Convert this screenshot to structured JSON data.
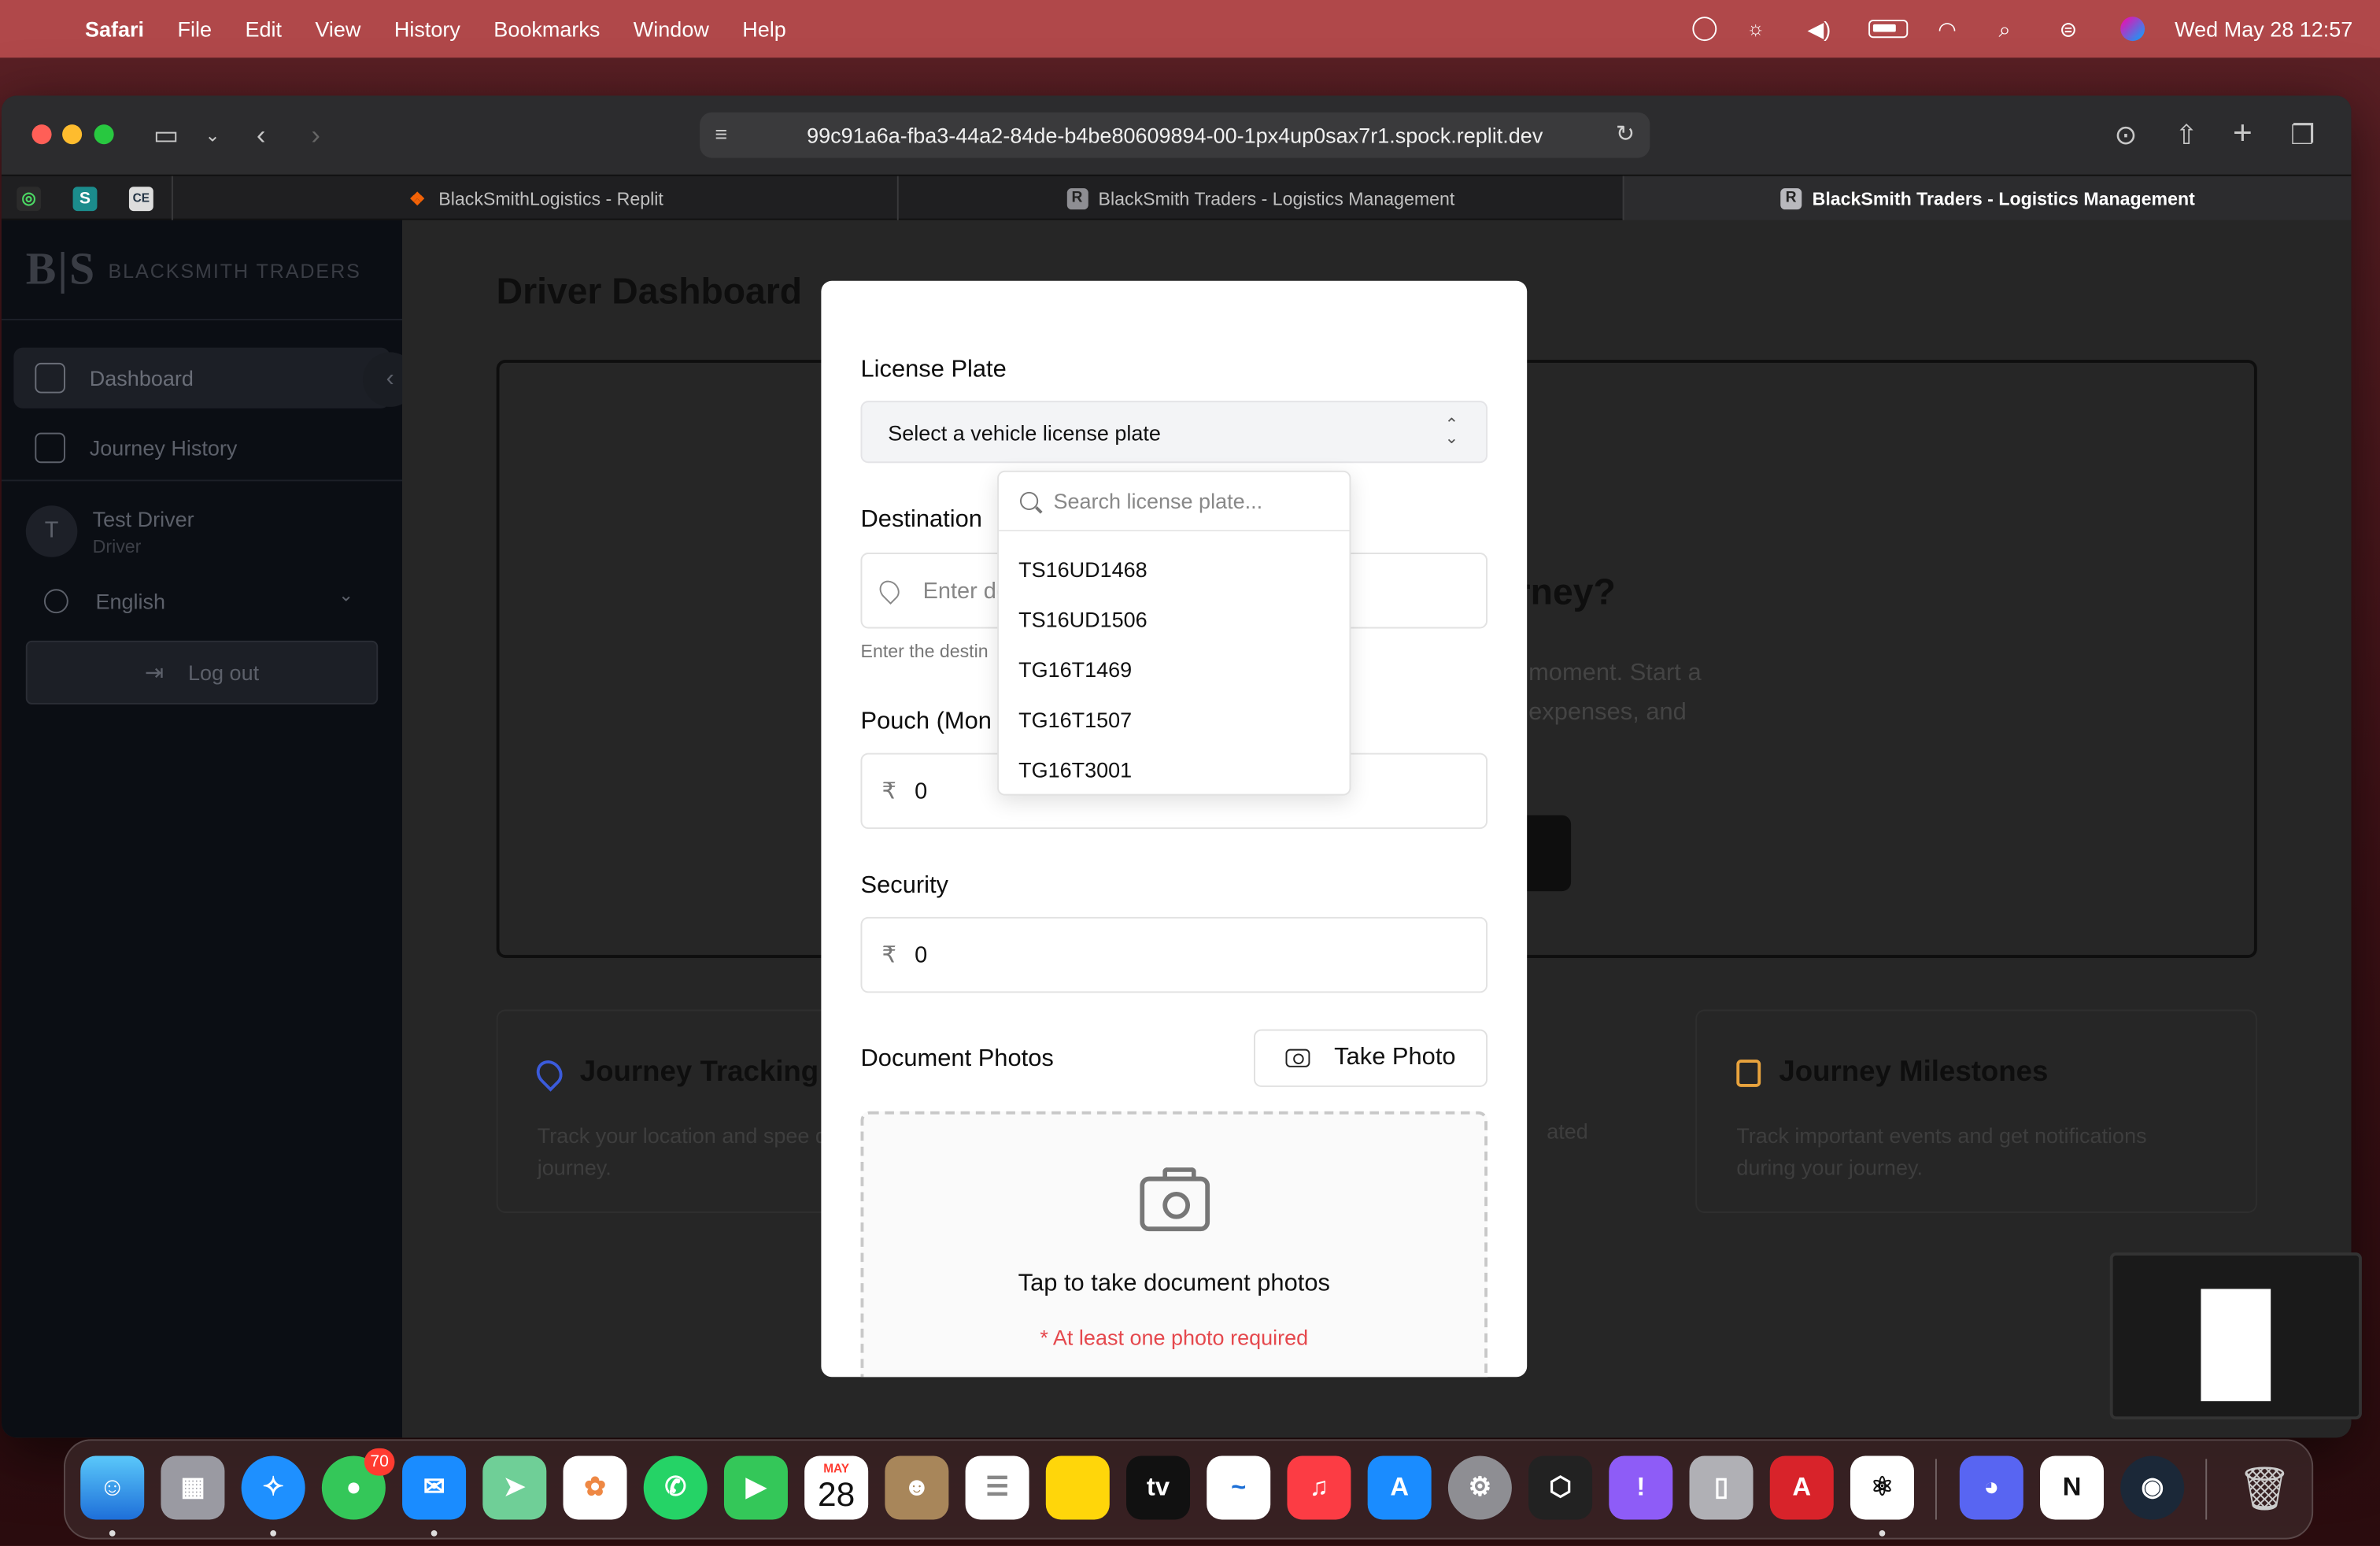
{
  "menubar": {
    "app": "Safari",
    "items": [
      "File",
      "Edit",
      "View",
      "History",
      "Bookmarks",
      "Window",
      "Help"
    ],
    "clock": "Wed May 28  12:57"
  },
  "browser": {
    "url": "99c91a6a-fba3-44a2-84de-b4be80609894-00-1px4up0sax7r1.spock.replit.dev",
    "tabs": [
      {
        "label": "BlackSmithLogistics - Replit",
        "favicon": "replit"
      },
      {
        "label": "BlackSmith Traders - Logistics Management",
        "favicon": "R"
      },
      {
        "label": "BlackSmith Traders - Logistics Management",
        "favicon": "R",
        "active": true
      }
    ]
  },
  "sidebar": {
    "brand_logo": "B|S",
    "brand_name": "BLACKSMITH TRADERS",
    "nav": [
      {
        "label": "Dashboard",
        "icon": "home-icon"
      },
      {
        "label": "Journey History",
        "icon": "clipboard-icon"
      }
    ],
    "user": {
      "initial": "T",
      "name": "Test Driver",
      "role": "Driver"
    },
    "language": "English",
    "logout_label": "Log out"
  },
  "main": {
    "title": "Driver Dashboard",
    "hero_heading_partial": "rney?",
    "hero_desc_partial": "moment. Start a expenses, and",
    "features": [
      {
        "title": "Journey Tracking",
        "desc": "Track your location and spee during your journey.",
        "icon": "map-pin-icon",
        "color": "#3b5bdb"
      },
      {
        "title": "Journey Milestones",
        "desc": "Track important events and get notifications during your journey.",
        "icon": "calendar-icon",
        "color": "#e8a33d"
      }
    ],
    "middle_card_partial": "ated"
  },
  "modal": {
    "license_label": "License Plate",
    "license_placeholder": "Select a vehicle license plate",
    "destination_label": "Destination",
    "destination_placeholder": "Enter de",
    "destination_helper": "Enter the destin",
    "pouch_label": "Pouch (Mon",
    "pouch_currency": "₹",
    "pouch_value": "0",
    "security_label": "Security",
    "security_currency": "₹",
    "security_value": "0",
    "photos_label": "Document Photos",
    "take_photo_label": "Take Photo",
    "dropzone_title": "Tap to take document photos",
    "dropzone_required": "* At least one photo required"
  },
  "plate_dropdown": {
    "search_placeholder": "Search license plate...",
    "options": [
      "TS16UD1468",
      "TS16UD1506",
      "TG16T1469",
      "TG16T1507",
      "TG16T3001"
    ]
  },
  "dock": {
    "messages_badge": "70",
    "calendar_month": "MAY",
    "calendar_day": "28"
  }
}
